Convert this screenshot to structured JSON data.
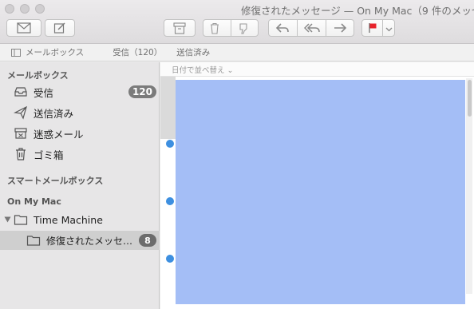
{
  "window": {
    "title": "修復されたメッセージ — On My Mac（9 件のメッセ"
  },
  "toolbar": {
    "icons": [
      "envelope-icon",
      "compose-icon",
      "archive-icon",
      "trash-icon",
      "junk-icon",
      "reply-icon",
      "reply-all-icon",
      "forward-icon",
      "flag-icon",
      "chevron-down-icon"
    ],
    "flag_color": "#e8232c"
  },
  "favorites": {
    "mailboxes": "メールボックス",
    "inbox": "受信（120）",
    "sent": "送信済み"
  },
  "sidebar": {
    "section_mailboxes": "メールボックス",
    "items": [
      {
        "label": "受信",
        "badge": "120"
      },
      {
        "label": "送信済み"
      },
      {
        "label": "迷惑メール"
      },
      {
        "label": "ゴミ箱"
      }
    ],
    "section_smart": "スマートメールボックス",
    "section_on_my_mac": "On My Mac",
    "folder": {
      "label": "Time Machine"
    },
    "subfolder": {
      "label": "修復されたメッセ…",
      "badge": "8"
    }
  },
  "list": {
    "sort_label": "日付で並べ替え ⌄",
    "selection_color": "#a4bef6",
    "unread_color": "#3d8fe0"
  }
}
